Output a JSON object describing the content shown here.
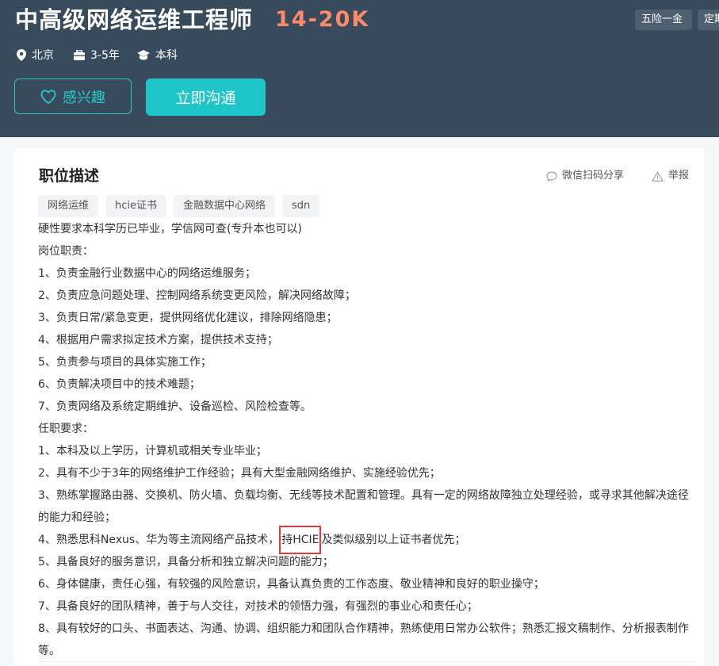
{
  "job": {
    "title": "中高级网络运维工程师",
    "salary": "14-20K",
    "city": "北京",
    "experience": "3-5年",
    "education": "本科",
    "welfare": [
      "五险一金",
      "定期"
    ]
  },
  "actions": {
    "interest_label": "感兴趣",
    "chat_label": "立即沟通"
  },
  "card": {
    "title": "职位描述",
    "share_label": "微信扫码分享",
    "report_label": "举报",
    "tags": [
      "网络运维",
      "hcie证书",
      "金融数据中心网络",
      "sdn"
    ]
  },
  "description": {
    "lines": [
      "硬性要求本科学历已毕业，学信网可查(专升本也可以)",
      "岗位职责：",
      "1、负责金融行业数据中心的网络运维服务；",
      "2、负责应急问题处理、控制网络系统变更风险，解决网络故障；",
      "3、负责日常/紧急变更，提供网络优化建议，排除网络隐患；",
      "4、根据用户需求拟定技术方案，提供技术支持；",
      "5、负责参与项目的具体实施工作；",
      "6、负责解决项目中的技术难题；",
      "7、负责网络及系统定期维护、设备巡检、风险检查等。",
      "任职要求：",
      "1、本科及以上学历，计算机或相关专业毕业；",
      "2、具有不少于3年的网络维护工作经验；具有大型金融网络维护、实施经验优先；",
      "3、熟练掌握路由器、交换机、防火墙、负载均衡、无线等技术配置和管理。具有一定的网络故障独立处理经验，或寻求其他解决途径的能力和经验；"
    ],
    "line4_before": "4、熟悉思科Nexus、华为等主流网络产品技术，",
    "line4_highlight": "持HCIE",
    "line4_after": "及类似级别以上证书者优先；",
    "lines_after": [
      "5、具备良好的服务意识，具备分析和独立解决问题的能力；",
      "6、身体健康，责任心强，有较强的风险意识，具备认真负责的工作态度、敬业精神和良好的职业操守；",
      "7、具备良好的团队精神，善于与人交往，对技术的领悟力强，有强烈的事业心和责任心；",
      "8、具有较好的口头、书面表达、沟通、协调、组织能力和团队合作精神，熟练使用日常办公软件；熟悉汇报文稿制作、分析报表制作等。"
    ]
  },
  "colors": {
    "header_bg": "#374b5d",
    "accent": "#1fc6c8",
    "salary": "#fe8a6a",
    "highlight_box": "#e53935"
  }
}
